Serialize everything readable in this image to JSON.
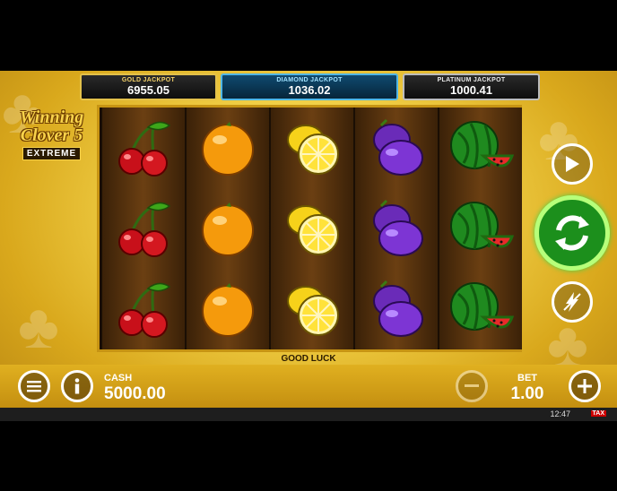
{
  "jackpots": [
    {
      "label": "GOLD JACKPOT",
      "value": "6955.05"
    },
    {
      "label": "DIAMOND JACKPOT",
      "value": "1036.02"
    },
    {
      "label": "PLATINUM JACKPOT",
      "value": "1000.41"
    }
  ],
  "logo": {
    "line1": "Winning",
    "line2": "Clover 5",
    "line3": "EXTREME"
  },
  "reels": [
    [
      "cherry-icon",
      "cherry-icon",
      "cherry-icon"
    ],
    [
      "orange-icon",
      "orange-icon",
      "orange-icon"
    ],
    [
      "lemon-icon",
      "lemon-icon",
      "lemon-icon"
    ],
    [
      "plum-icon",
      "plum-icon",
      "plum-icon"
    ],
    [
      "watermelon-icon",
      "watermelon-icon",
      "watermelon-icon"
    ]
  ],
  "message": "GOOD LUCK",
  "cash": {
    "label": "CASH",
    "value": "5000.00"
  },
  "bet": {
    "label": "BET",
    "value": "1.00"
  },
  "clock": "12:47",
  "brand": "TAX",
  "colors": {
    "gold": "#e3c14a",
    "diamond": "#4fb6e6",
    "spin": "#1c8f1c",
    "reel": "#6b3f12"
  }
}
